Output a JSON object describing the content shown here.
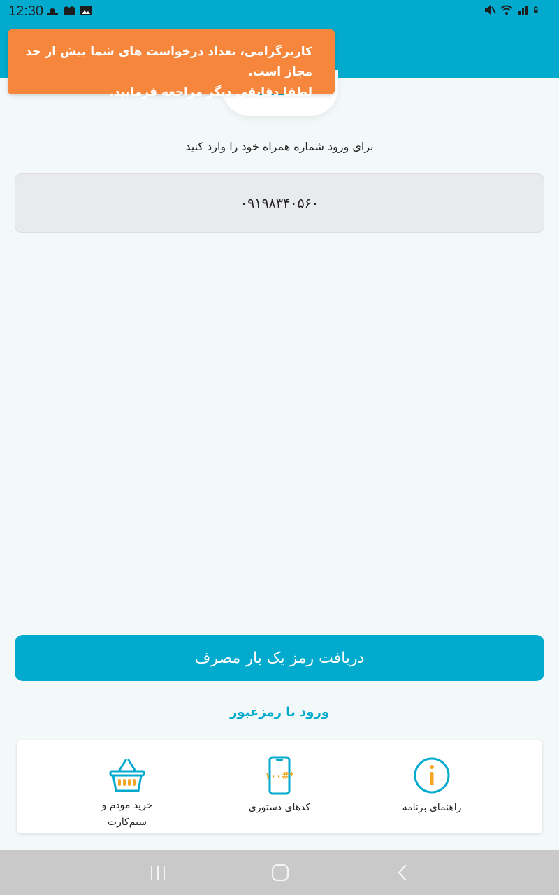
{
  "status_bar": {
    "time": "12:30",
    "left_icons": [
      "weather-icon",
      "notification-icon",
      "gallery-icon"
    ],
    "right_icons": [
      "mute-icon",
      "wifi-icon",
      "signal-icon",
      "battery-icon"
    ]
  },
  "toast": {
    "line1": "کاربرگرامی، تعداد درخواست های شما بیش از حد مجاز است.",
    "line2": "لطفا دقایقی دیگر مراجعه فرمایید."
  },
  "login": {
    "prompt": "برای ورود شماره همراه خود را وارد کنید",
    "phone_value": "۰۹۱۹۸۳۴۰۵۶۰",
    "otp_button_label": "دریافت رمز یک بار مصرف",
    "password_link_label": "ورود با رمزعبور"
  },
  "quick_actions": {
    "help_label": "راهنمای برنامه",
    "ussd_label": "کدهای دستوری",
    "ussd_icon_text": "*۱۰۰#",
    "shop_label_line1": "خرید مودم و",
    "shop_label_line2": "سیم‌کارت"
  },
  "colors": {
    "primary": "#02aacd",
    "toast": "#f5863b",
    "icon_accent": "#f5a623"
  }
}
